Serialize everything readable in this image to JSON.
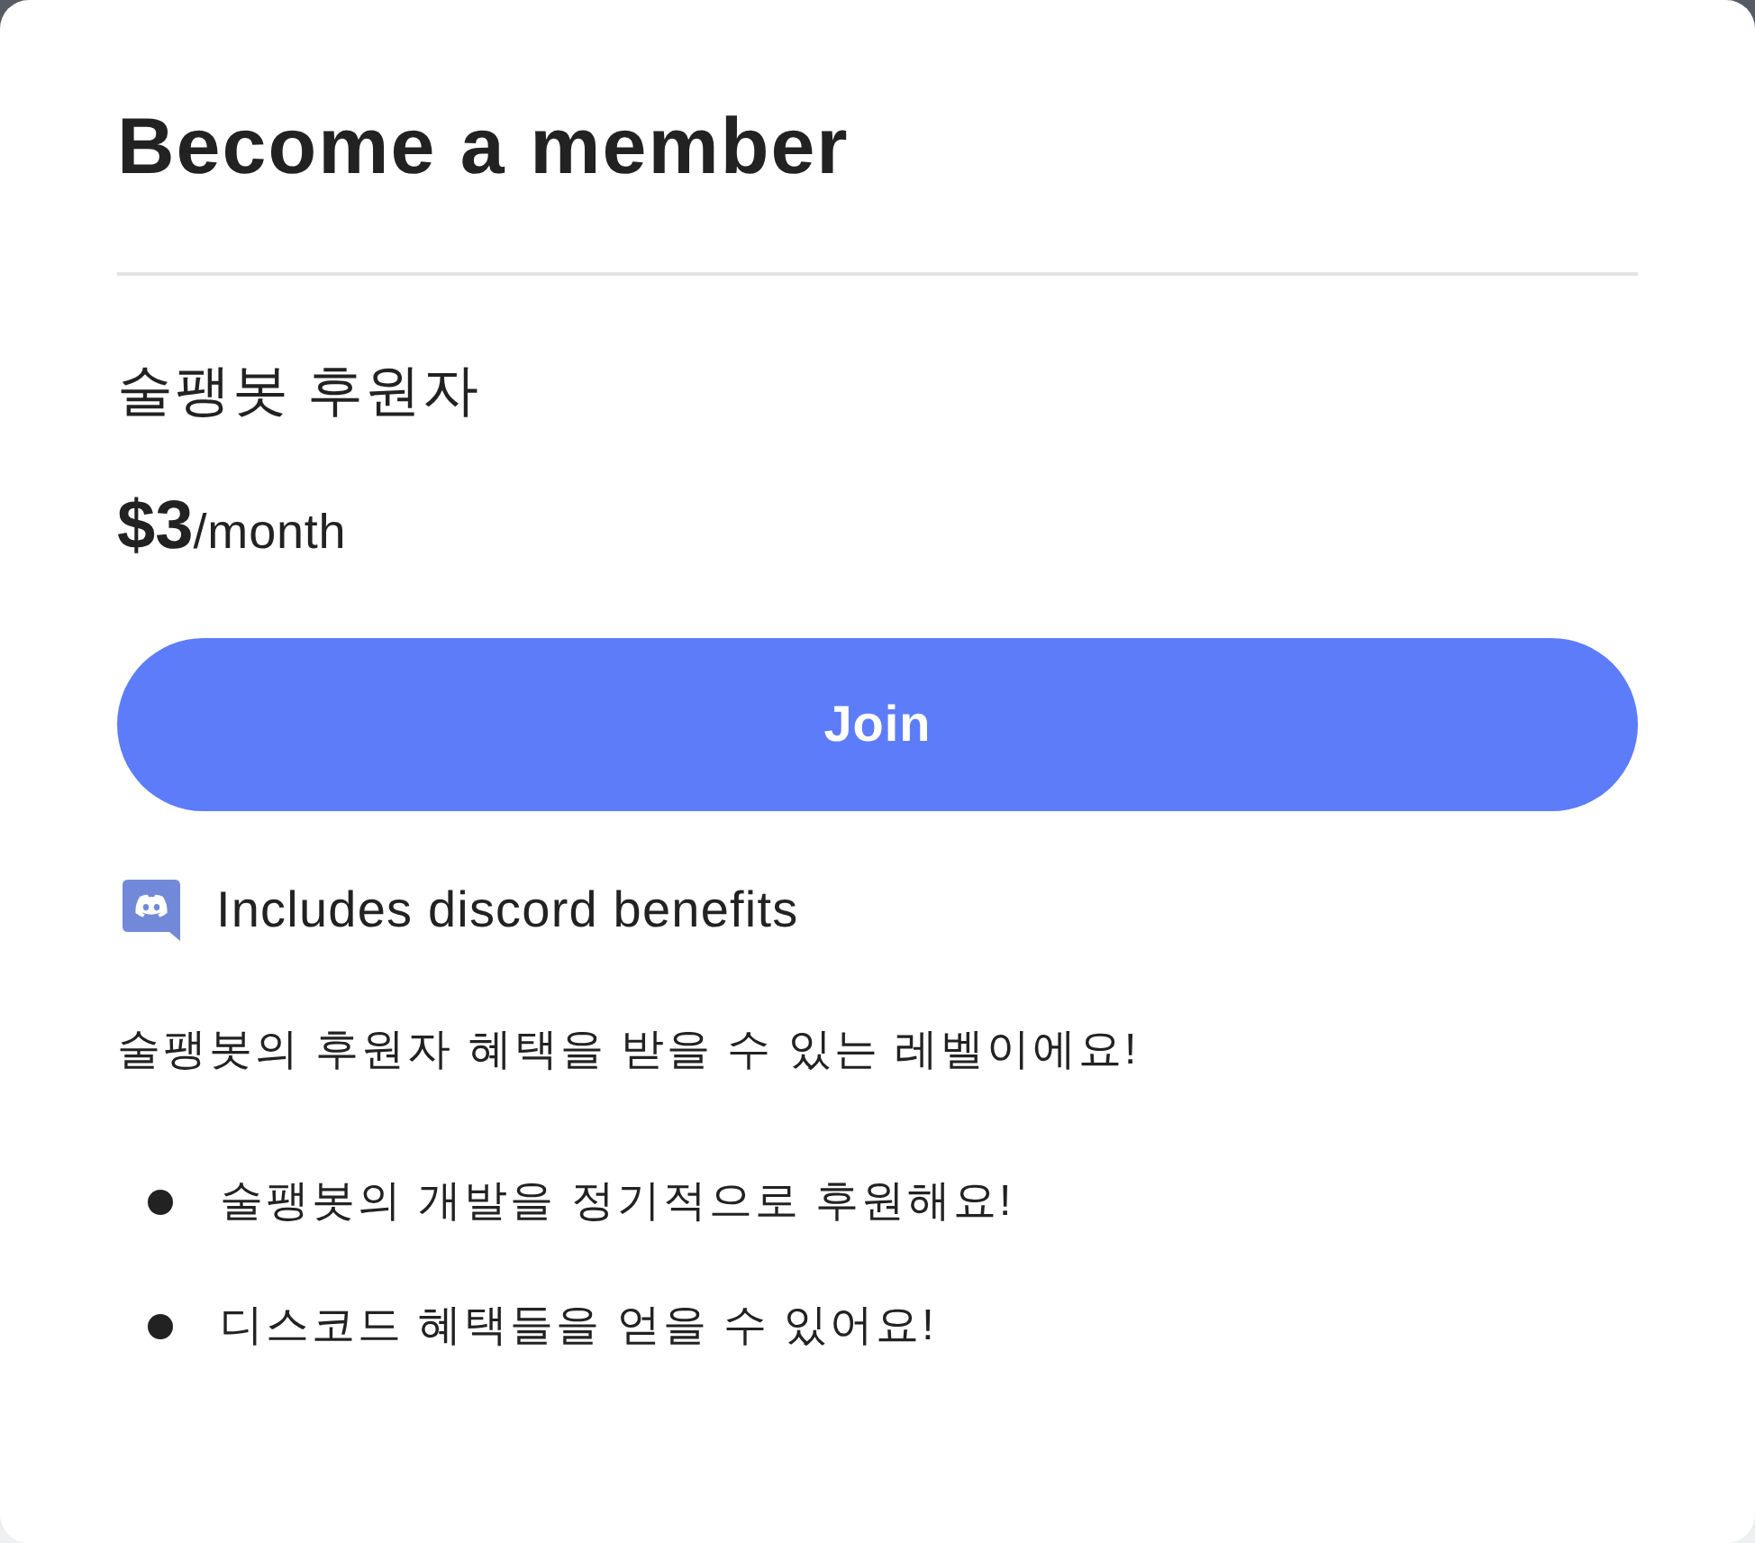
{
  "dialog": {
    "title": "Become a member"
  },
  "tier": {
    "name": "술팽봇 후원자",
    "price": "$3",
    "period": "/month"
  },
  "join_button": {
    "label": "Join"
  },
  "discord": {
    "label": "Includes discord benefits"
  },
  "description": "술팽봇의 후원자 혜택을 받을 수 있는 레벨이에요!",
  "benefits": [
    "술팽봇의 개발을 정기적으로 후원해요!",
    "디스코드 혜택들을 얻을 수 있어요!"
  ]
}
